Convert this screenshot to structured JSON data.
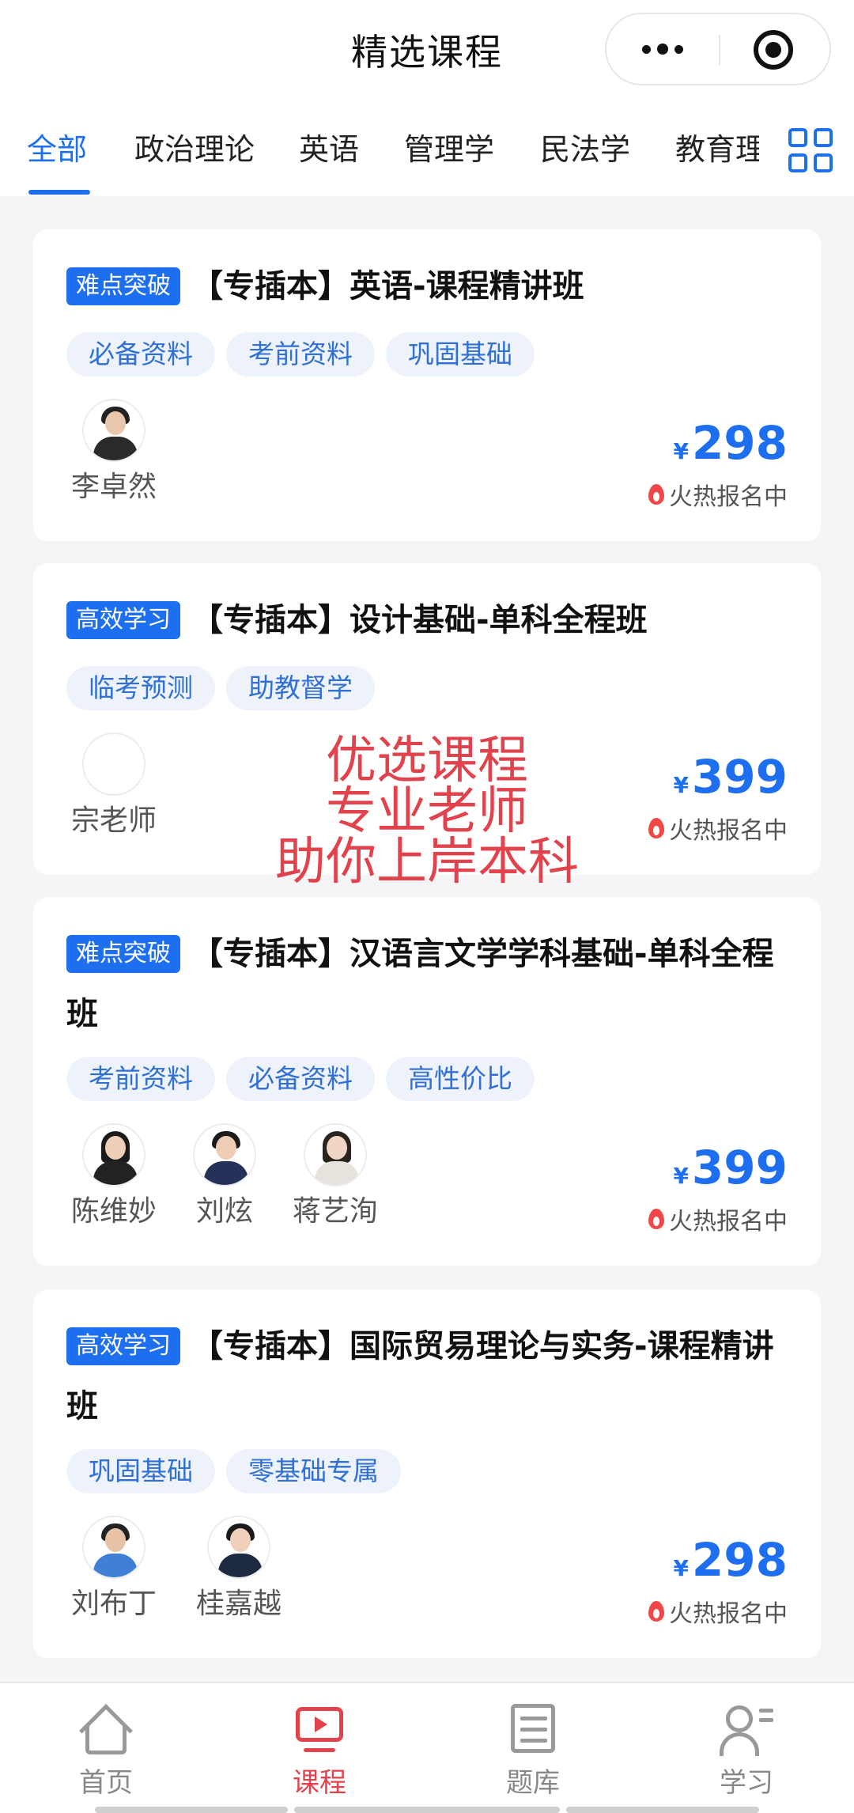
{
  "header": {
    "title": "精选课程"
  },
  "tabs": [
    "全部",
    "政治理论",
    "英语",
    "管理学",
    "民法学",
    "教育理"
  ],
  "active_tab": 0,
  "cards": [
    {
      "badge": "难点突破",
      "title": "【专插本】英语-课程精讲班",
      "tags": [
        "必备资料",
        "考前资料",
        "巩固基础"
      ],
      "teachers": [
        "李卓然"
      ],
      "currency": "¥",
      "price": "298",
      "status": "火热报名中"
    },
    {
      "badge": "高效学习",
      "title": "【专插本】设计基础-单科全程班",
      "tags": [
        "临考预测",
        "助教督学"
      ],
      "teachers": [
        "宗老师"
      ],
      "currency": "¥",
      "price": "399",
      "status": "火热报名中"
    },
    {
      "badge": "难点突破",
      "title": "【专插本】汉语言文学学科基础-单科全程班",
      "tags": [
        "考前资料",
        "必备资料",
        "高性价比"
      ],
      "teachers": [
        "陈维妙",
        "刘炫",
        "蒋艺洵"
      ],
      "currency": "¥",
      "price": "399",
      "status": "火热报名中"
    },
    {
      "badge": "高效学习",
      "title": "【专插本】国际贸易理论与实务-课程精讲班",
      "tags": [
        "巩固基础",
        "零基础专属"
      ],
      "teachers": [
        "刘布丁",
        "桂嘉越"
      ],
      "currency": "¥",
      "price": "298",
      "status": "火热报名中"
    }
  ],
  "overlay": {
    "line1": "优选课程",
    "line2": "专业老师",
    "line3": "助你上岸本科"
  },
  "bottom_nav": [
    {
      "label": "首页",
      "icon": "home-icon"
    },
    {
      "label": "课程",
      "icon": "course-icon"
    },
    {
      "label": "题库",
      "icon": "quiz-icon"
    },
    {
      "label": "学习",
      "icon": "study-icon"
    }
  ],
  "active_nav": 1,
  "colors": {
    "accent": "#1d6ff0",
    "nav_active": "#e2424b",
    "flame": "#f04848"
  }
}
